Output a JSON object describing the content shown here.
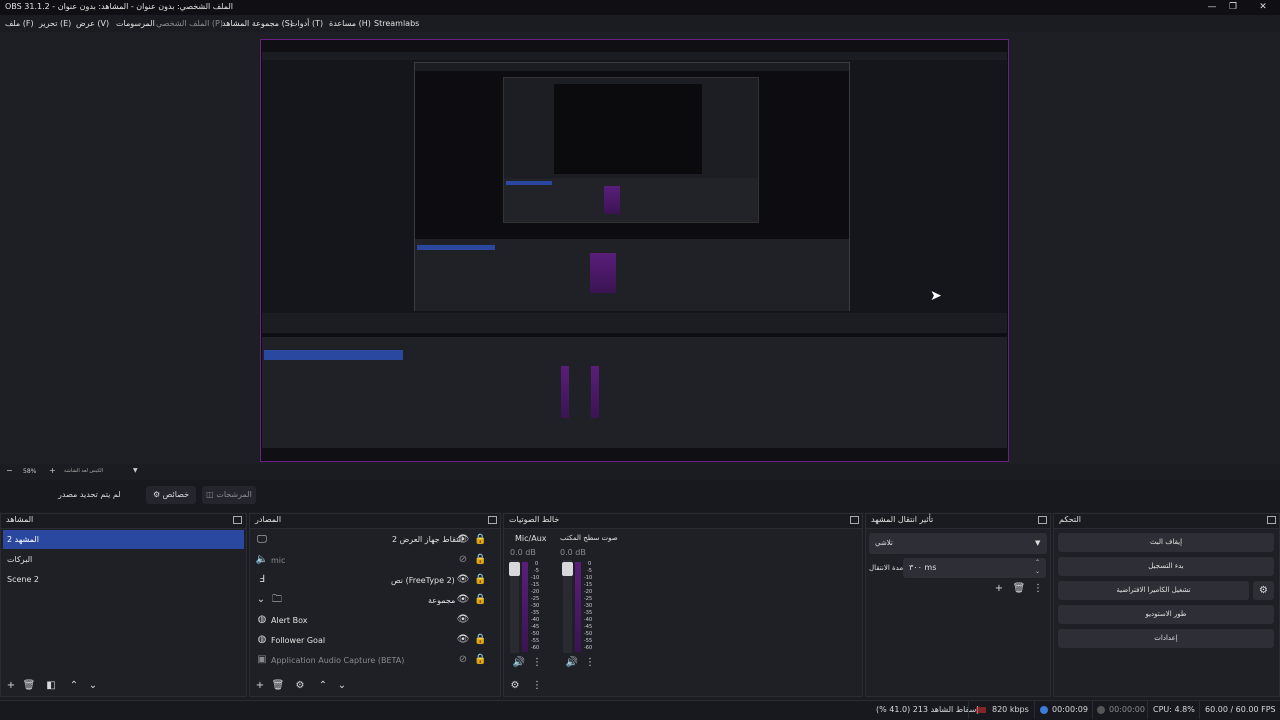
{
  "window": {
    "title": "OBS 31.1.2 - الملف الشخصي: بدون عنوان - المشاهد: بدون عنوان",
    "controls": {
      "minimize": "—",
      "maximize": "❐",
      "close": "✕"
    }
  },
  "menu": {
    "items": [
      {
        "label": "ملف (F)"
      },
      {
        "label": "تحرير (E)"
      },
      {
        "label": "عرض (V)"
      },
      {
        "label": "المرسومات"
      },
      {
        "label": "الملف الشخصي (P)"
      },
      {
        "label": "مجموعة المشاهد (S)"
      },
      {
        "label": "أدوات (T)"
      },
      {
        "label": "مساعدة (H)"
      },
      {
        "label": "Streamlabs"
      }
    ]
  },
  "zoom": {
    "minus": "−",
    "value": "58%",
    "plus": "+",
    "label": "الكيس لعد الشاشة"
  },
  "toolbar": {
    "no_source": "لم يتم تحديد مصدر",
    "properties": "خصائص",
    "filters": "المرشحات"
  },
  "scenes": {
    "title": "المشاهد",
    "items": [
      {
        "label": "المشهد 2",
        "selected": true
      },
      {
        "label": "البركات",
        "selected": false
      },
      {
        "label": "Scene 2",
        "selected": false
      }
    ]
  },
  "sources": {
    "title": "المصادر",
    "items": [
      {
        "label": "التقاط جهاز العرض 2",
        "icon": "monitor-icon",
        "visible": true,
        "locked": true,
        "dim": false
      },
      {
        "label": "mic",
        "icon": "speaker-icon",
        "visible": false,
        "locked": true,
        "dim": true
      },
      {
        "label": "نص (FreeType 2)",
        "icon": "text-icon",
        "visible": true,
        "locked": true,
        "dim": false
      },
      {
        "label": "مجموعة",
        "icon": "folder-icon",
        "visible": true,
        "locked": true,
        "dim": false
      },
      {
        "label": "Alert Box",
        "icon": "browser-icon",
        "visible": true,
        "locked": false,
        "dim": false
      },
      {
        "label": "Follower Goal",
        "icon": "browser-icon",
        "visible": true,
        "locked": true,
        "dim": false
      },
      {
        "label": "Application Audio Capture (BETA)",
        "icon": "app-audio-icon",
        "visible": false,
        "locked": true,
        "dim": true
      }
    ]
  },
  "mixer": {
    "title": "خالط الصوتيات",
    "channels": [
      {
        "name": "Mic/Aux",
        "db": "0.0 dB"
      },
      {
        "name": "صوت سطح المكتب",
        "db": "0.0 dB"
      }
    ],
    "scale": [
      "0",
      "-5",
      "-10",
      "-15",
      "-20",
      "-25",
      "-30",
      "-35",
      "-40",
      "-45",
      "-50",
      "-55",
      "-60"
    ]
  },
  "transitions": {
    "title": "تأثير انتقال المشهد",
    "selected": "تلاشي",
    "duration_label": "مدة الانتقال",
    "duration_value": "٣٠٠ ms"
  },
  "controls": {
    "title": "التحكم",
    "buttons": [
      {
        "label": "إيقاف البث"
      },
      {
        "label": "بدء التسجيل"
      },
      {
        "label": "تشغيل الكاميرا الافتراضية"
      },
      {
        "label": "طور الاستوديو"
      },
      {
        "label": "إعدادات"
      }
    ]
  },
  "status": {
    "dropped": "إسقاط الشاهد 213 (41.0 %)",
    "bitrate": "820 kbps",
    "stream_time": "00:00:09",
    "rec_time": "00:00:00",
    "cpu": "CPU: 4.8%",
    "fps": "60.00 / 60.00 FPS"
  },
  "colors": {
    "accent": "#2b48a0",
    "canvas_border": "#6b1f86",
    "meter": "#5a1e7a",
    "live_dot": "#3b7bd9",
    "rec_dot": "#cc2d2d"
  }
}
